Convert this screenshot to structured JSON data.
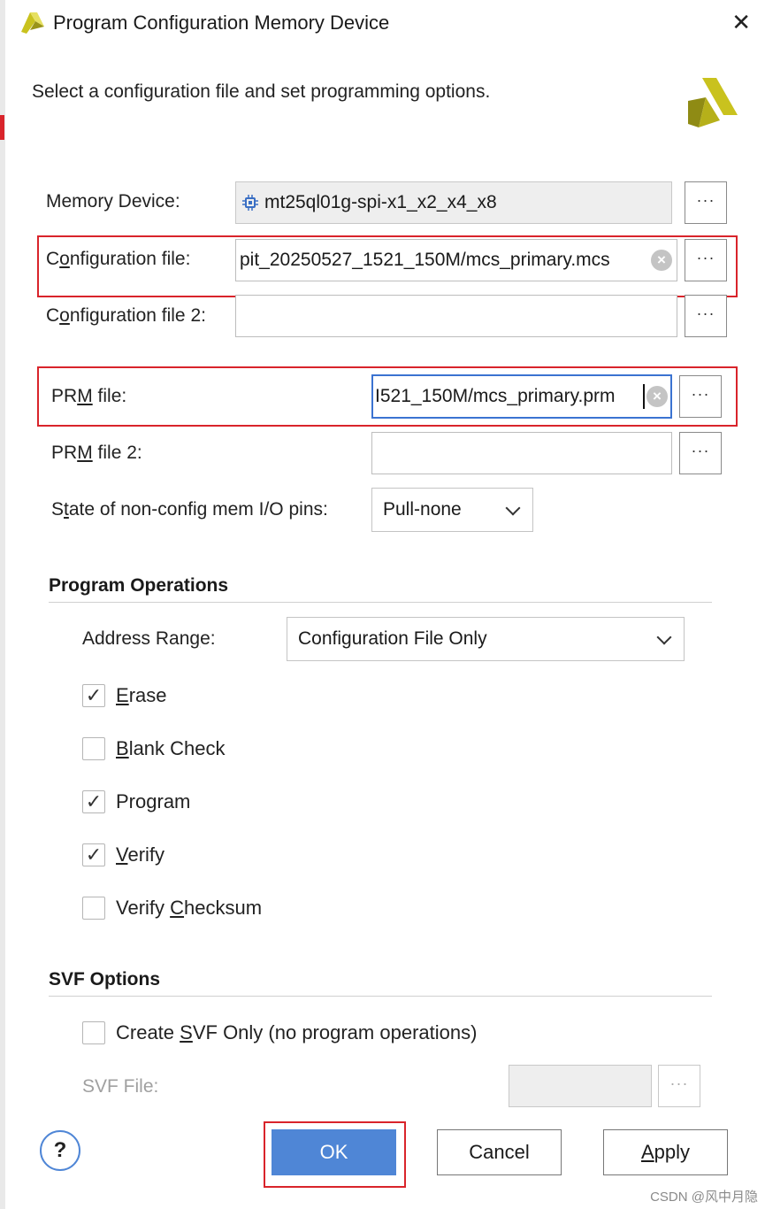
{
  "window": {
    "title": "Program Configuration Memory Device",
    "close_glyph": "✕"
  },
  "header": {
    "subtitle": "Select a configuration file and set programming options."
  },
  "memory_device": {
    "label": "Memory Device:",
    "value": "mt25ql01g-spi-x1_x2_x4_x8"
  },
  "config_file": {
    "label_pre": "C",
    "label_u": "o",
    "label_post": "nfiguration file:",
    "value": "pit_20250527_1521_150M/mcs_primary.mcs"
  },
  "config_file_2": {
    "label_pre": "C",
    "label_u": "o",
    "label_post": "nfiguration file 2:",
    "value": ""
  },
  "prm_file": {
    "label_pre": "PR",
    "label_u": "M",
    "label_post": " file:",
    "value": "I521_150M/mcs_primary.prm"
  },
  "prm_file_2": {
    "label_pre": "PR",
    "label_u": "M",
    "label_post": " file 2:",
    "value": ""
  },
  "io_pins": {
    "label_pre": "S",
    "label_u": "t",
    "label_post": "ate of non-config mem I/O pins:",
    "value": "Pull-none"
  },
  "browse_label": "···",
  "program_operations": {
    "title": "Program Operations",
    "address_range_label_pre": "Address Ran",
    "address_range_label_u": "g",
    "address_range_label_post": "e:",
    "address_range_value": "Configuration File Only",
    "erase": {
      "u": "E",
      "rest": "rase",
      "checked": true
    },
    "blank_check": {
      "u": "B",
      "rest": "lank Check",
      "checked": false
    },
    "program": {
      "pre": "Pro",
      "u": "g",
      "rest": "ram",
      "checked": true
    },
    "verify": {
      "u": "V",
      "rest": "erify",
      "checked": true
    },
    "verify_checksum": {
      "pre": "Verify ",
      "u": "C",
      "rest": "hecksum",
      "checked": false
    }
  },
  "svf_options": {
    "title": "SVF Options",
    "create_pre": "Create ",
    "create_u": "S",
    "create_post": "VF Only (no program operations)",
    "create_checked": false,
    "svf_file_label": "SVF File:"
  },
  "footer": {
    "help": "?",
    "ok": "OK",
    "cancel": "Cancel",
    "apply_u": "A",
    "apply_rest": "pply"
  },
  "watermark": "CSDN @风中月隐",
  "colors": {
    "highlight_red": "#d9242b",
    "ok_blue": "#4f86d6",
    "focus_blue": "#3b73d1"
  }
}
